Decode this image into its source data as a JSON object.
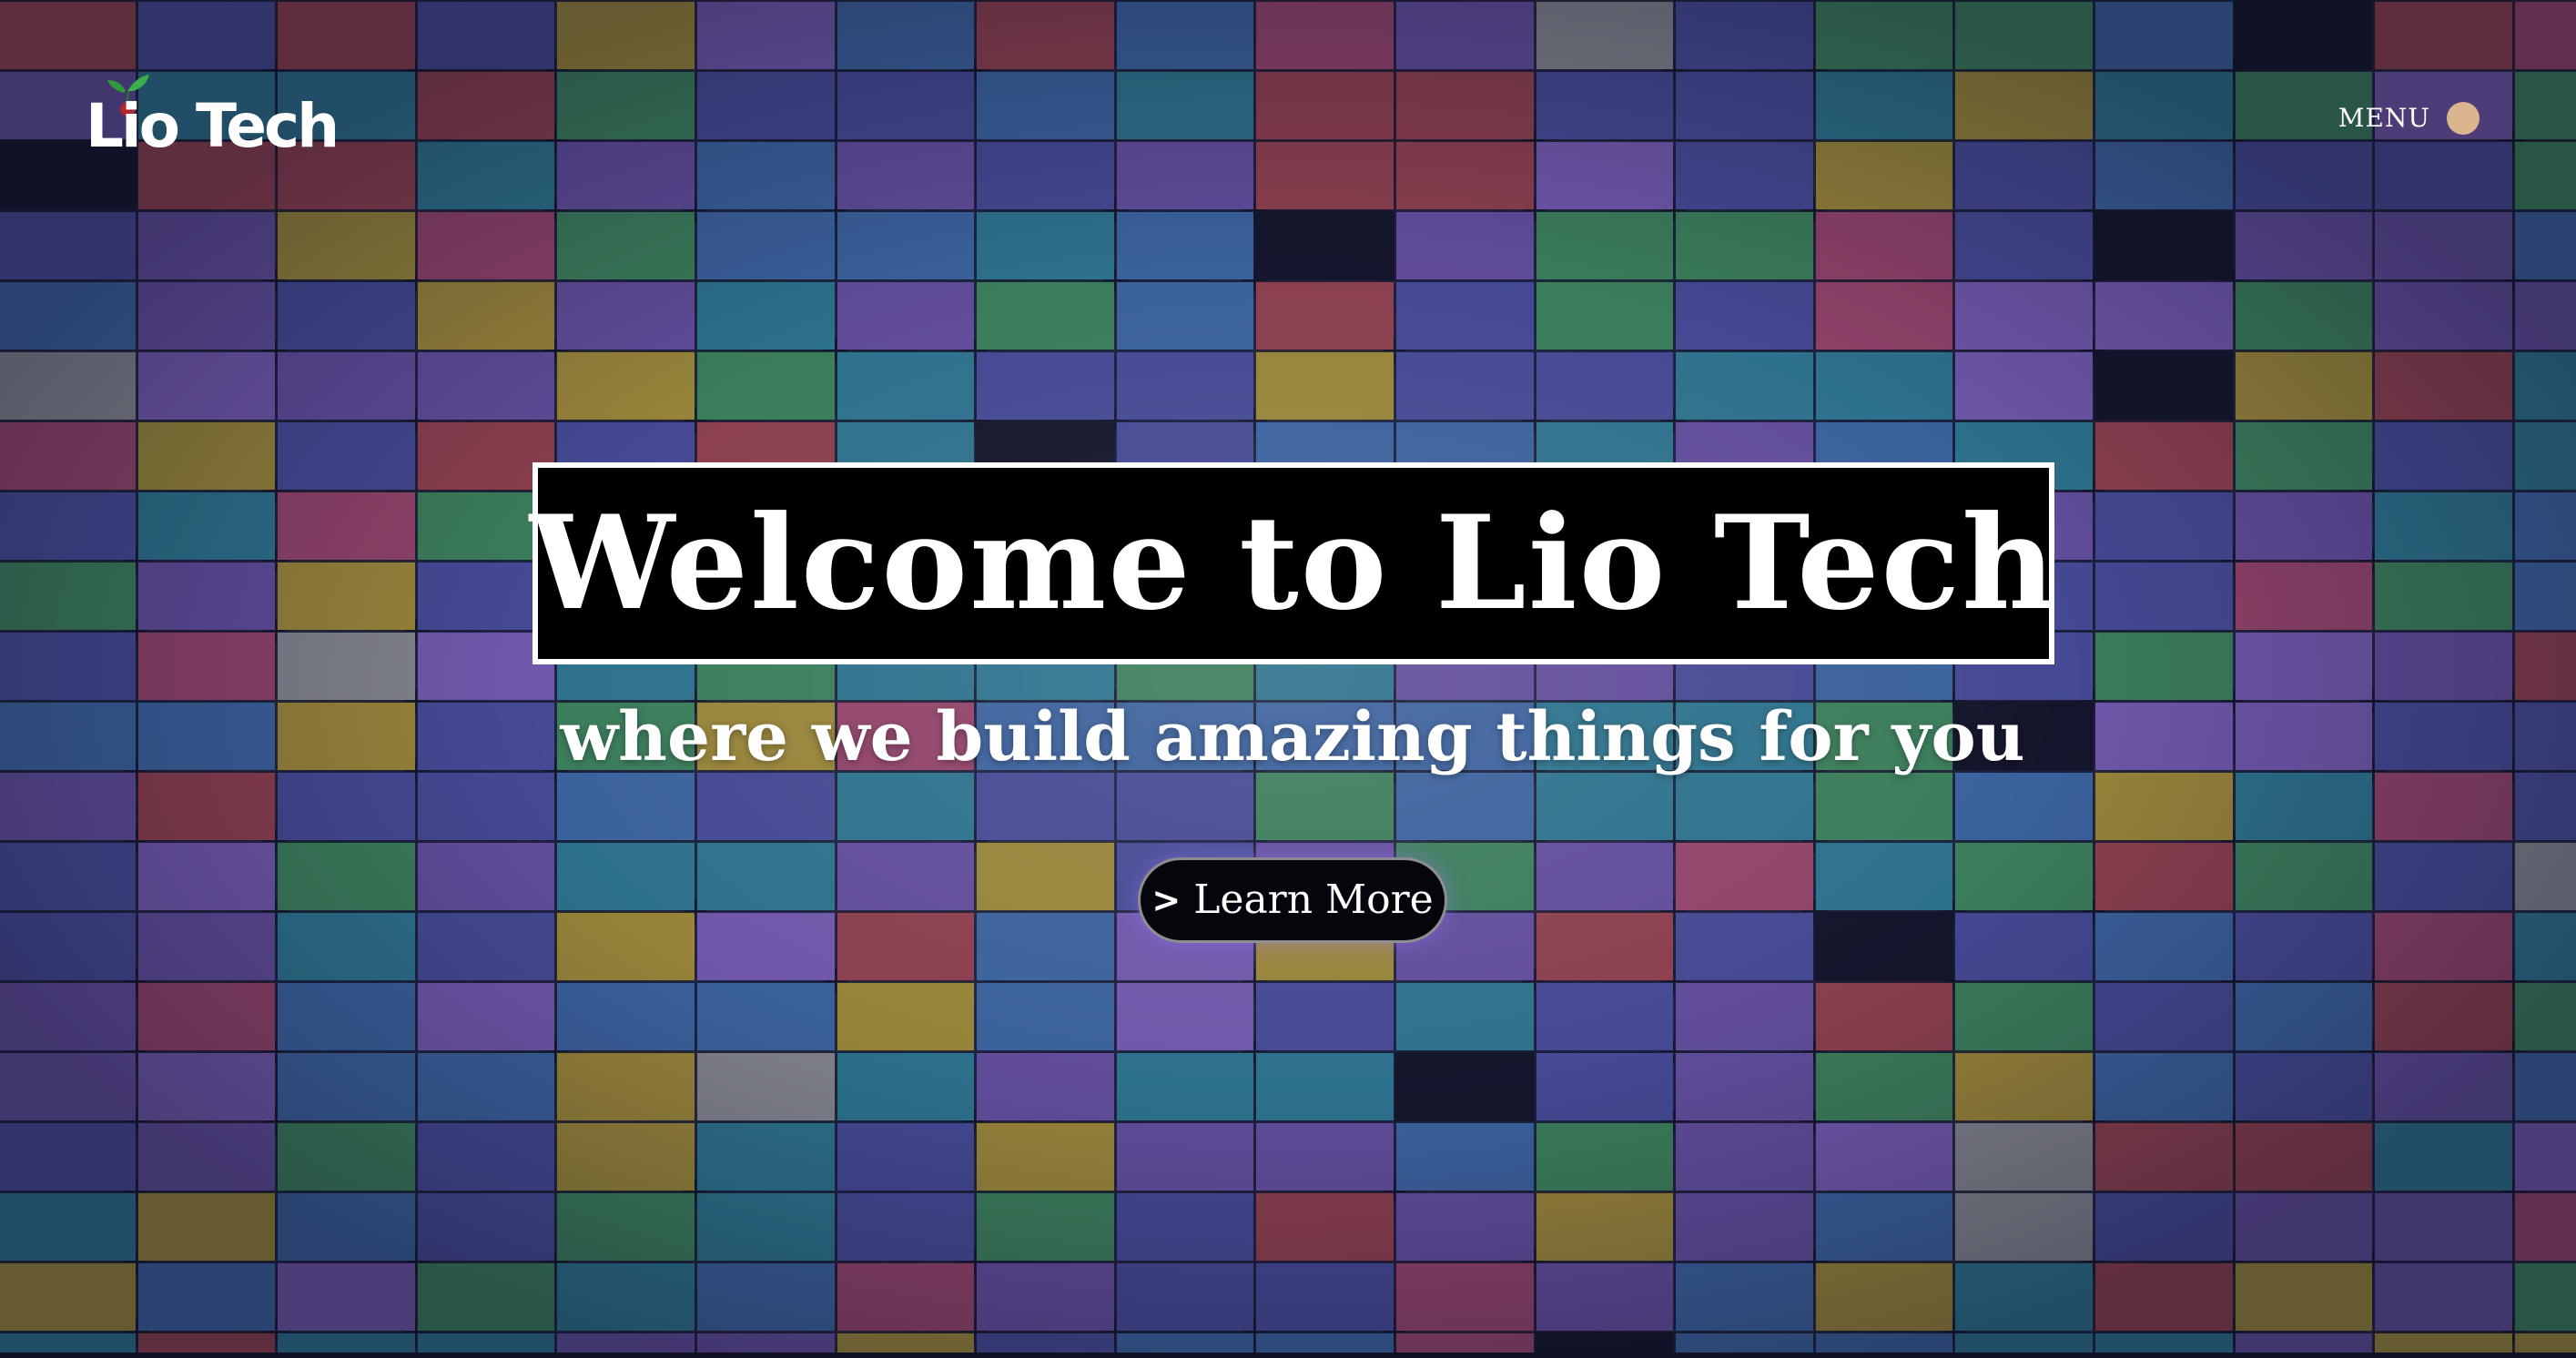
{
  "header": {
    "logo_text": "Lio Tech",
    "menu_label": "MENU"
  },
  "hero": {
    "title": "Welcome to Lio Tech",
    "subtitle": "where we build amazing things for you",
    "cta_chevron": ">",
    "cta_label": "Learn More"
  },
  "icons": {
    "logo": "cherry-icon",
    "menu": "menu-dot-icon"
  },
  "colors": {
    "menu_dot": "#dbb58e",
    "title_box_bg": "#000000",
    "button_bg": "#05060c",
    "tile_palette": {
      "blue": "#3f6aa8",
      "indigo": "#4a4f9e",
      "purple": "#6a53a6",
      "violet": "#7b5fb8",
      "teal": "#2f7d96",
      "green": "#3f8a5e",
      "red": "#9a4450",
      "rose": "#a0486e",
      "yellow": "#a89238",
      "gray": "#8e9096",
      "dark": "#121428"
    }
  }
}
